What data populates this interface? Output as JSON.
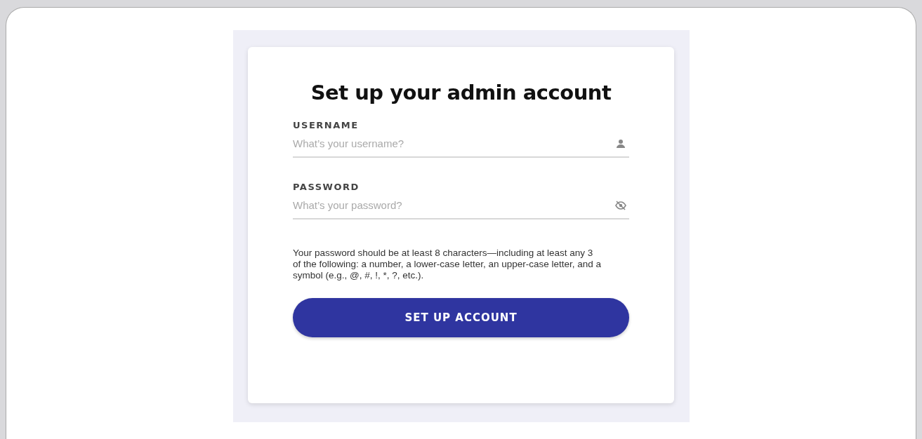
{
  "form": {
    "title": "Set up your admin account",
    "fields": [
      {
        "label": "USERNAME",
        "placeholder": "What’s your username?",
        "kind": "user"
      },
      {
        "label": "PASSWORD",
        "placeholder": "What’s your password?",
        "kind": "password"
      }
    ],
    "hint": "Your password should be at least 8 characters—including at least any 3 of the following: a number, a lower-case letter, an upper-case letter, and a symbol (e.g., @, #, !, *, ?, etc.).",
    "button": "SET UP ACCOUNT"
  }
}
